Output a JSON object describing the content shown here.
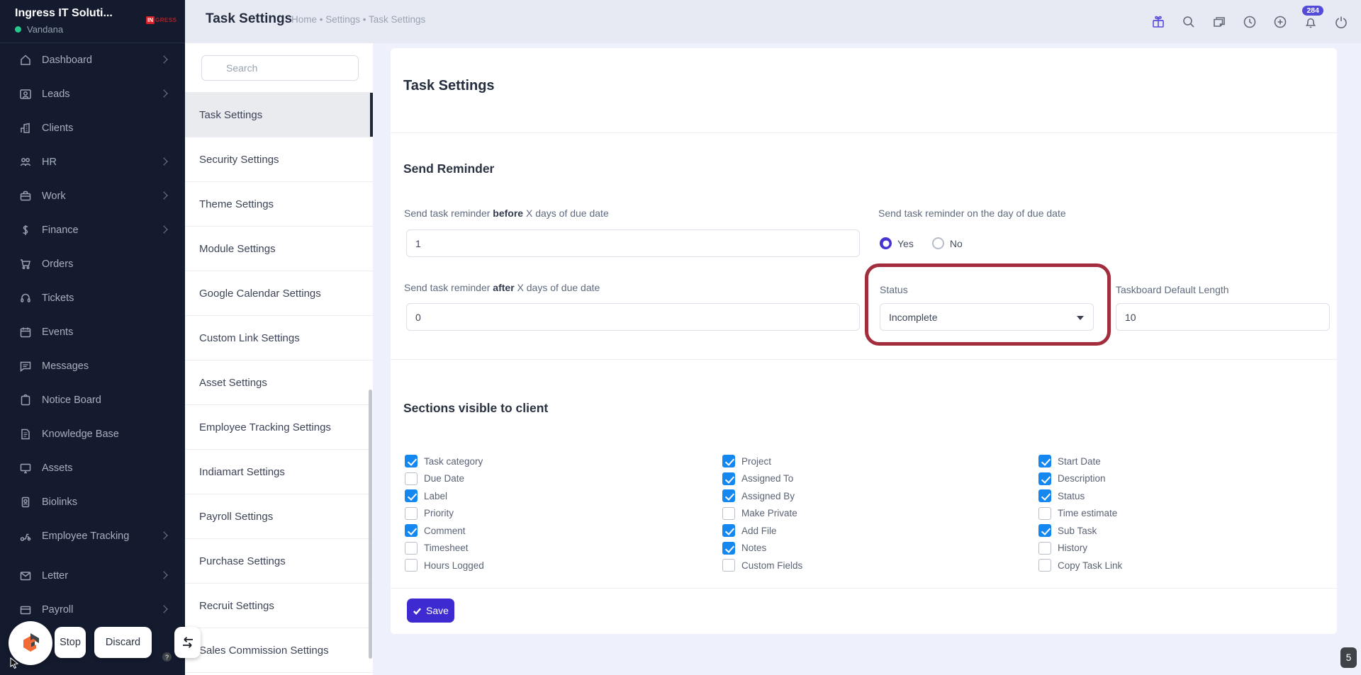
{
  "workspace": {
    "company": "Ingress IT Soluti...",
    "user": "Vandana",
    "logo_prefix": "IN",
    "logo_suffix": "GRESS"
  },
  "header": {
    "title": "Task Settings",
    "breadcrumb": "Home • Settings • Task Settings",
    "notification_count": "284"
  },
  "sidebar": {
    "items": [
      {
        "label": "Dashboard",
        "icon": "home-icon",
        "has_submenu": true
      },
      {
        "label": "Leads",
        "icon": "lead-badge-icon",
        "has_submenu": true
      },
      {
        "label": "Clients",
        "icon": "building-icon",
        "has_submenu": false
      },
      {
        "label": "HR",
        "icon": "people-icon",
        "has_submenu": true
      },
      {
        "label": "Work",
        "icon": "briefcase-icon",
        "has_submenu": true
      },
      {
        "label": "Finance",
        "icon": "dollar-icon",
        "has_submenu": true
      },
      {
        "label": "Orders",
        "icon": "cart-icon",
        "has_submenu": false
      },
      {
        "label": "Tickets",
        "icon": "headset-icon",
        "has_submenu": false
      },
      {
        "label": "Events",
        "icon": "calendar-icon",
        "has_submenu": false
      },
      {
        "label": "Messages",
        "icon": "chat-icon",
        "has_submenu": false
      },
      {
        "label": "Notice Board",
        "icon": "clipboard-icon",
        "has_submenu": false
      },
      {
        "label": "Knowledge Base",
        "icon": "document-icon",
        "has_submenu": false
      },
      {
        "label": "Assets",
        "icon": "monitor-icon",
        "has_submenu": false
      },
      {
        "label": "Biolinks",
        "icon": "id-card-icon",
        "has_submenu": false
      },
      {
        "label": "Employee Tracking",
        "icon": "scooter-icon",
        "has_submenu": true
      },
      {
        "label": "Letter",
        "icon": "envelope-icon",
        "has_submenu": true
      },
      {
        "label": "Payroll",
        "icon": "wallet-icon",
        "has_submenu": true
      }
    ]
  },
  "settings_nav": {
    "search_placeholder": "Search",
    "active_item": "Task Settings",
    "items": [
      "Task Settings",
      "Security Settings",
      "Theme Settings",
      "Module Settings",
      "Google Calendar Settings",
      "Custom Link Settings",
      "Asset Settings",
      "Employee Tracking Settings",
      "Indiamart Settings",
      "Payroll Settings",
      "Purchase Settings",
      "Recruit Settings",
      "Sales Commission Settings"
    ]
  },
  "main": {
    "card_title": "Task Settings",
    "send_reminder": {
      "heading": "Send Reminder",
      "before_label": {
        "prefix": "Send task reminder ",
        "bold": "before",
        "suffix": " X days of due date"
      },
      "before_value": "1",
      "after_label": {
        "prefix": "Send task reminder ",
        "bold": "after",
        "suffix": " X days of due date"
      },
      "after_value": "0",
      "day_of_label": "Send task reminder on the day of due date",
      "day_of_options": [
        {
          "label": "Yes",
          "selected": true
        },
        {
          "label": "No",
          "selected": false
        }
      ],
      "status_label": "Status",
      "status_value": "Incomplete",
      "taskboard_label": "Taskboard Default Length",
      "taskboard_value": "10"
    },
    "sections": {
      "heading": "Sections visible to client",
      "columns": [
        {
          "items": [
            {
              "label": "Task category",
              "checked": true
            },
            {
              "label": "Due Date",
              "checked": false
            },
            {
              "label": "Label",
              "checked": true
            },
            {
              "label": "Priority",
              "checked": false
            },
            {
              "label": "Comment",
              "checked": true
            },
            {
              "label": "Timesheet",
              "checked": false
            },
            {
              "label": "Hours Logged",
              "checked": false
            }
          ]
        },
        {
          "items": [
            {
              "label": "Project",
              "checked": true
            },
            {
              "label": "Assigned To",
              "checked": true
            },
            {
              "label": "Assigned By",
              "checked": true
            },
            {
              "label": "Make Private",
              "checked": false
            },
            {
              "label": "Add File",
              "checked": true
            },
            {
              "label": "Notes",
              "checked": true
            },
            {
              "label": "Custom Fields",
              "checked": false
            }
          ]
        },
        {
          "items": [
            {
              "label": "Start Date",
              "checked": true
            },
            {
              "label": "Description",
              "checked": true
            },
            {
              "label": "Status",
              "checked": true
            },
            {
              "label": "Time estimate",
              "checked": false
            },
            {
              "label": "Sub Task",
              "checked": true
            },
            {
              "label": "History",
              "checked": false
            },
            {
              "label": "Copy Task Link",
              "checked": false
            }
          ]
        }
      ]
    },
    "save_label": "Save"
  },
  "overlay": {
    "stop_label": "Stop",
    "discard_label": "Discard",
    "help_label": "?"
  },
  "page_badge": "5",
  "colors": {
    "sidebar_bg": "#141b2f",
    "header_bg": "#e7eaf2",
    "accent_purple": "#5a4de0",
    "save_button": "#3e2ad1",
    "checkbox_checked": "#1487f0",
    "radio_selected": "#4534d2",
    "annotation_red": "#a32c3d",
    "online_green": "#27c78c"
  }
}
